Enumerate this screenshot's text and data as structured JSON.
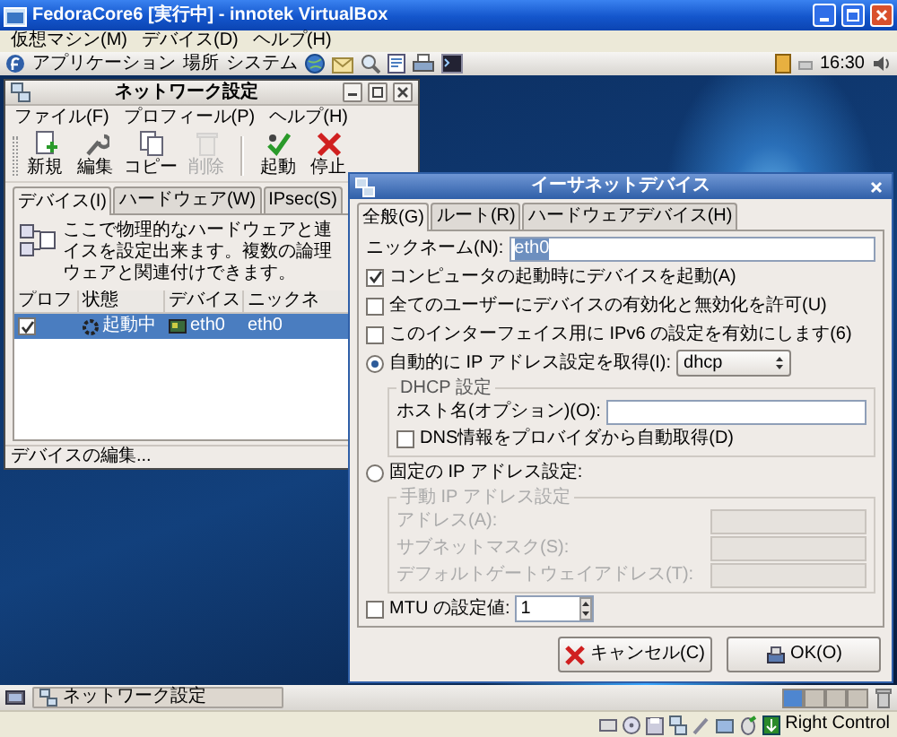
{
  "host_window": {
    "title": "FedoraCore6 [実行中] - innotek VirtualBox",
    "menu": [
      "仮想マシン(M)",
      "デバイス(D)",
      "ヘルプ(H)"
    ]
  },
  "guest_top_panel": {
    "menus": [
      "アプリケーション",
      "場所",
      "システム"
    ],
    "clock": "16:30"
  },
  "network_window": {
    "title": "ネットワーク設定",
    "menu": [
      "ファイル(F)",
      "プロフィール(P)",
      "ヘルプ(H)"
    ],
    "toolbar_groups": [
      [
        {
          "label": "新規",
          "kind": "new",
          "disabled": false
        },
        {
          "label": "編集",
          "kind": "edit",
          "disabled": false
        },
        {
          "label": "コピー",
          "kind": "copy",
          "disabled": false
        },
        {
          "label": "削除",
          "kind": "delete",
          "disabled": true
        }
      ],
      [
        {
          "label": "起動",
          "kind": "start",
          "disabled": false
        },
        {
          "label": "停止",
          "kind": "stop",
          "disabled": false
        }
      ]
    ],
    "tabs": [
      {
        "label": "デバイス(I)",
        "selected": true
      },
      {
        "label": "ハードウェア(W)",
        "selected": false
      },
      {
        "label": "IPsec(S)",
        "selected": false
      }
    ],
    "info_lines": [
      "ここで物理的なハードウェアと連",
      "イスを設定出来ます。複数の論理",
      "ウェアと関連付けできます。"
    ],
    "table": {
      "columns": [
        "プロフ",
        "状態",
        "デバイス",
        "ニックネ"
      ],
      "rows": [
        {
          "active": true,
          "status": "起動中",
          "device": "eth0",
          "nickname": "eth0",
          "selected": true
        }
      ]
    },
    "status_bar": "デバイスの編集..."
  },
  "ethernet_dialog": {
    "title": "イーサネットデバイス",
    "tabs": [
      {
        "label": "全般(G)",
        "selected": true
      },
      {
        "label": "ルート(R)",
        "selected": false
      },
      {
        "label": "ハードウェアデバイス(H)",
        "selected": false
      }
    ],
    "nickname": {
      "label": "ニックネーム(N):",
      "value": "eth0",
      "value_selected": true
    },
    "options": [
      {
        "label": "コンピュータの起動時にデバイスを起動(A)",
        "checked": true
      },
      {
        "label": "全てのユーザーにデバイスの有効化と無効化を許可(U)",
        "checked": false
      },
      {
        "label": "このインターフェイス用に IPv6 の設定を有効にします(6)",
        "checked": false
      }
    ],
    "auto_ip": {
      "label": "自動的に IP アドレス設定を取得(I):",
      "selected": true,
      "protocol": "dhcp",
      "dhcp_group": {
        "legend": "DHCP 設定",
        "hostname_label": "ホスト名(オプション)(O):",
        "dns_label": "DNS情報をプロバイダから自動取得(D)",
        "dns_checked": false
      }
    },
    "static_ip": {
      "label": "固定の IP アドレス設定:",
      "selected": false,
      "group": {
        "legend": "手動 IP アドレス設定",
        "disabled": true,
        "fields": [
          "アドレス(A):",
          "サブネットマスク(S):",
          "デフォルトゲートウェイアドレス(T):"
        ]
      }
    },
    "mtu": {
      "label": "MTU の設定値:",
      "checked": false,
      "value": "1"
    },
    "buttons": [
      {
        "label": "キャンセル(C)",
        "kind": "cancel"
      },
      {
        "label": "OK(O)",
        "kind": "ok"
      }
    ]
  },
  "guest_bottom_panel": {
    "tasks": [
      {
        "label": "ネットワーク設定"
      }
    ],
    "workspaces": [
      {
        "selected": true
      },
      {
        "selected": false
      },
      {
        "selected": false
      },
      {
        "selected": false
      }
    ]
  },
  "host_status_bar": {
    "host_key": "Right Control"
  }
}
